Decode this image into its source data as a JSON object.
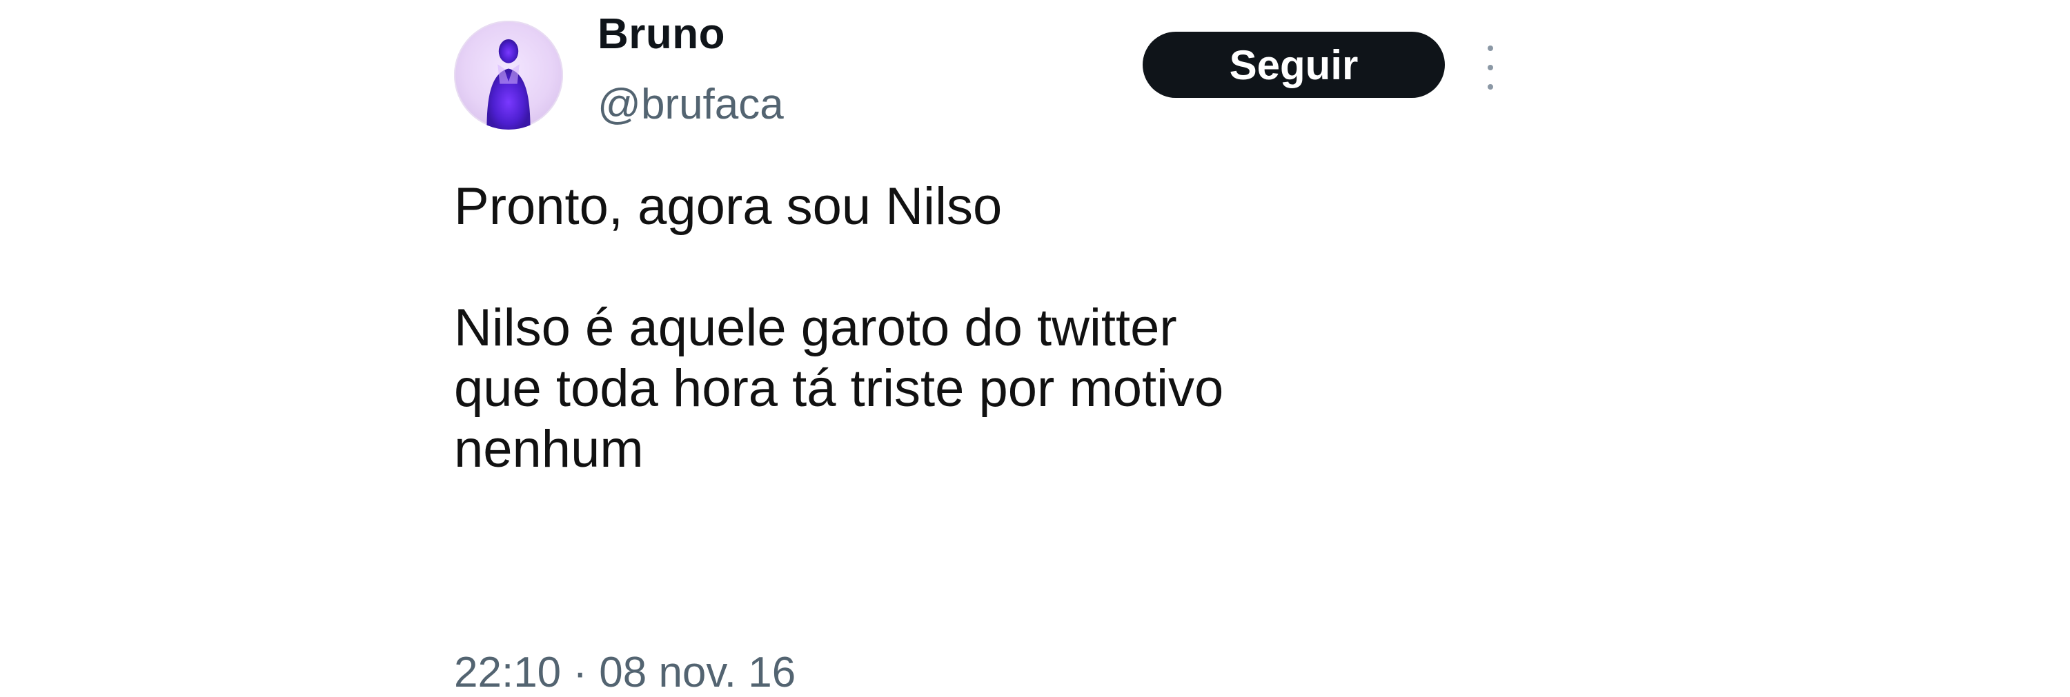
{
  "author": {
    "display_name": "Bruno",
    "handle": "@brufaca",
    "avatar_icon": "profile-photo"
  },
  "actions": {
    "follow_label": "Seguir",
    "more_icon": "more-vertical-icon"
  },
  "tweet": {
    "lines": [
      "Pronto, agora sou Nilso",
      "Nilso é aquele garoto do twitter",
      "que toda hora tá triste por motivo",
      "nenhum"
    ],
    "timestamp": "22:10 · 08 nov. 16"
  },
  "colors": {
    "follow_button_bg": "#0f1419",
    "secondary_text": "#536471",
    "avatar_accent": "#5b2bd6"
  }
}
